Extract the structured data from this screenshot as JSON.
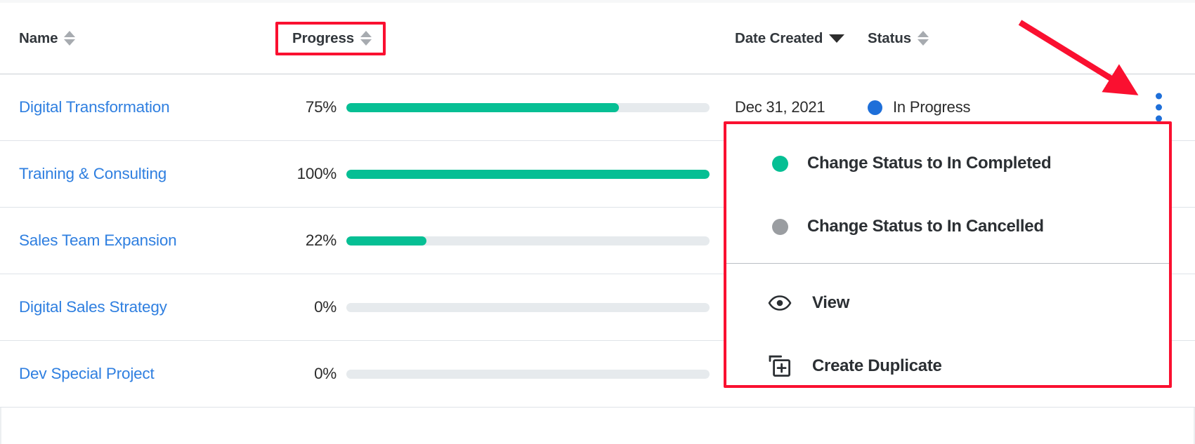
{
  "table": {
    "columns": [
      {
        "key": "name",
        "label": "Name",
        "sort_icon": "sort-both-icon"
      },
      {
        "key": "progress",
        "label": "Progress",
        "sort_icon": "sort-both-icon",
        "highlighted": true
      },
      {
        "key": "date",
        "label": "Date Created",
        "sort_icon": "sort-desc-icon"
      },
      {
        "key": "status",
        "label": "Status",
        "sort_icon": "sort-both-icon"
      }
    ],
    "rows": [
      {
        "name": "Digital Transformation",
        "progress_label": "75%",
        "progress_value": 75,
        "date": "Dec 31, 2021",
        "status": "In Progress",
        "status_color": "#1e6fd9",
        "has_kebab": true
      },
      {
        "name": "Training & Consulting",
        "progress_label": "100%",
        "progress_value": 100,
        "date": "",
        "status": "",
        "status_color": "",
        "has_kebab": false
      },
      {
        "name": "Sales Team Expansion",
        "progress_label": "22%",
        "progress_value": 22,
        "date": "",
        "status": "",
        "status_color": "",
        "has_kebab": false
      },
      {
        "name": "Digital Sales Strategy",
        "progress_label": "0%",
        "progress_value": 0,
        "date": "",
        "status": "",
        "status_color": "",
        "has_kebab": false
      },
      {
        "name": "Dev Special Project",
        "progress_label": "0%",
        "progress_value": 0,
        "date": "",
        "status": "",
        "status_color": "",
        "has_kebab": false
      }
    ]
  },
  "context_menu": {
    "items": [
      {
        "label": "Change Status to In Completed",
        "icon": "status-dot-icon",
        "color": "#06bf94"
      },
      {
        "label": "Change Status to In Cancelled",
        "icon": "status-dot-icon",
        "color": "#9a9da1"
      },
      {
        "label": "View",
        "icon": "eye-icon"
      },
      {
        "label": "Create Duplicate",
        "icon": "duplicate-plus-icon"
      }
    ]
  },
  "colors": {
    "progress_fill": "#06bf94",
    "progress_track": "#e6eaed",
    "link": "#2f7fe0",
    "annotation_red": "#fa1030",
    "kebab_blue": "#1e6fd9"
  }
}
